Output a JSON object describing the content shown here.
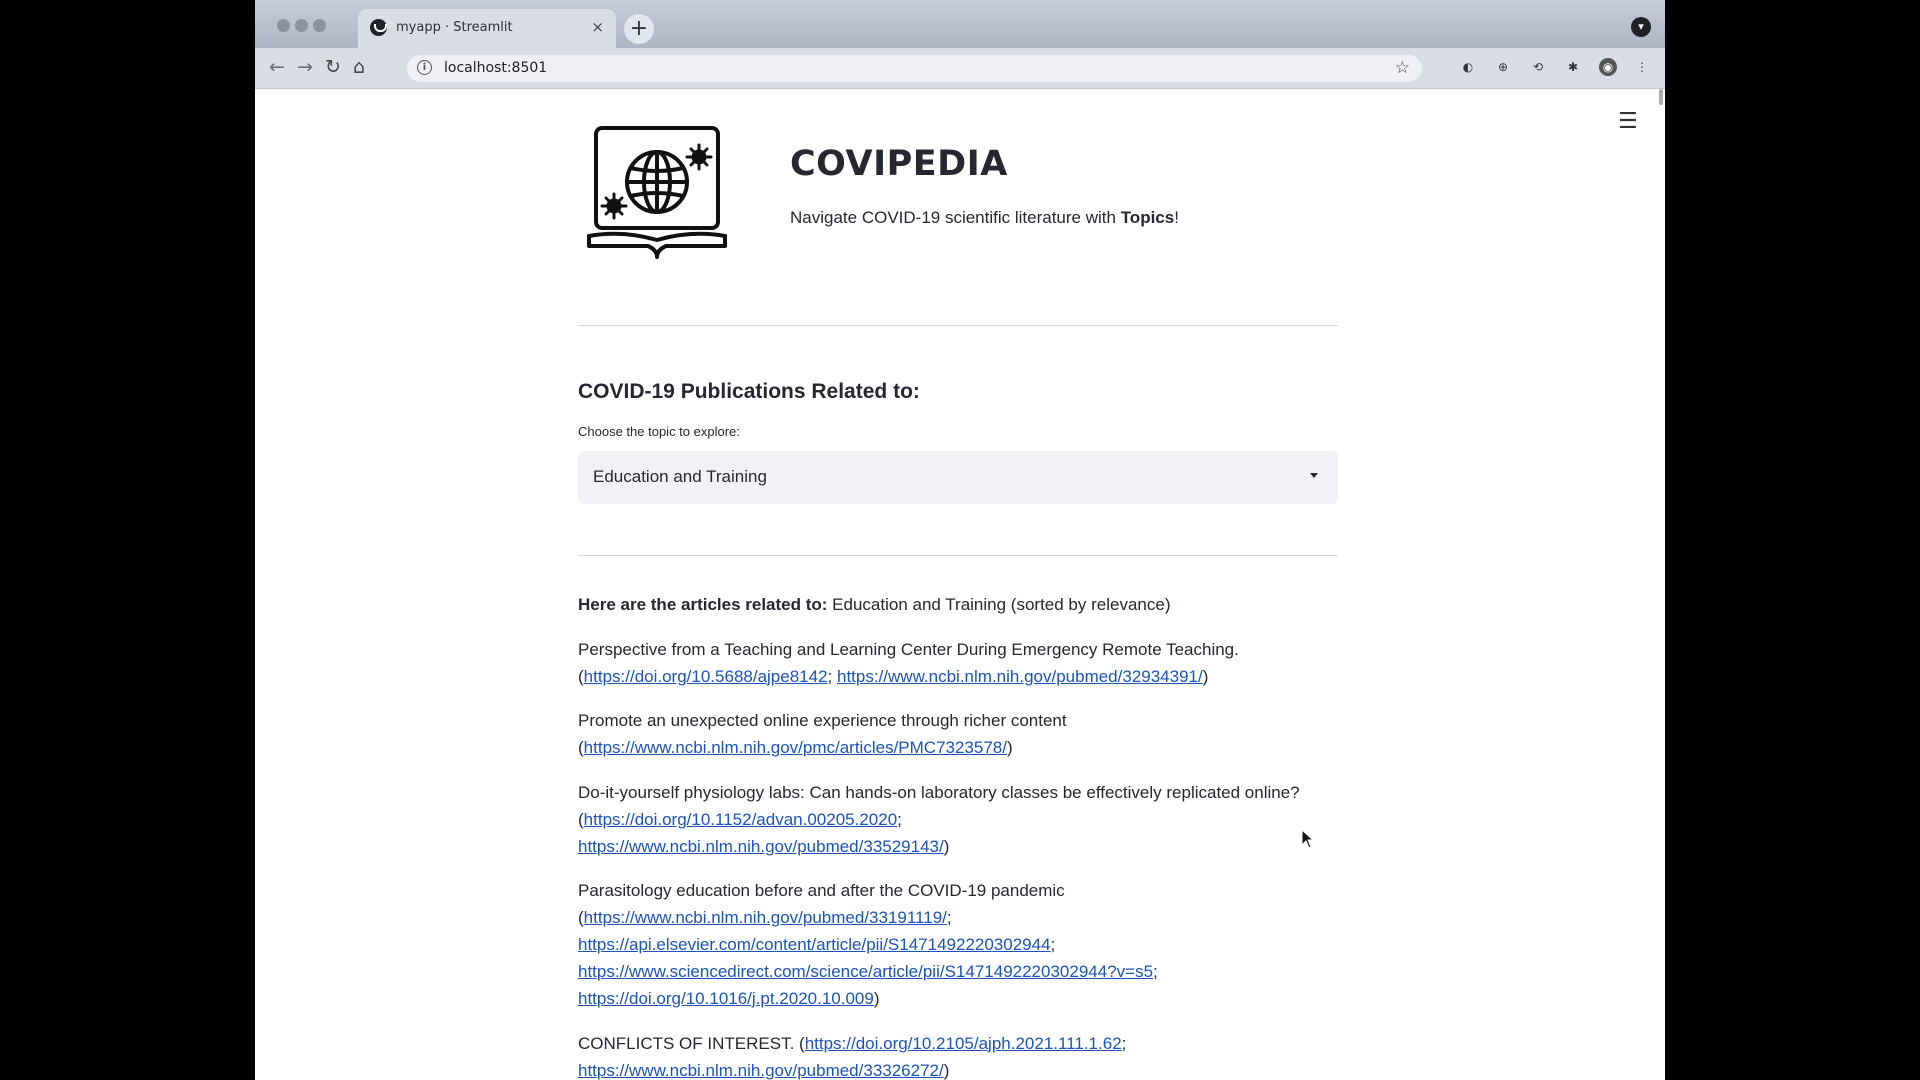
{
  "browser": {
    "tab_title": "myapp · Streamlit",
    "tab_close": "×",
    "new_tab": "+",
    "url": "localhost:8501",
    "info": "i",
    "star": "☆",
    "nav": {
      "back": "←",
      "forward": "→",
      "reload": "↻",
      "home": "⌂"
    },
    "extensions": [
      "◐",
      "⊕",
      "⟲",
      "✱",
      "◉"
    ],
    "menu": "⋮"
  },
  "app": {
    "menu_icon": "☰",
    "title": "COVIPEDIA",
    "tagline_prefix": "Navigate COVID-19 scientific literature with ",
    "tagline_bold": "Topics",
    "tagline_suffix": "!",
    "section_title": "COVID-19 Publications Related to:",
    "select_label": "Choose the topic to explore:",
    "selected_topic": "Education and Training",
    "results_heading_bold": "Here are the articles related to:",
    "results_heading_rest": " Education and Training (sorted by relevance)"
  },
  "articles": [
    {
      "title": "Perspective from a Teaching and Learning Center During Emergency Remote Teaching.",
      "links": [
        "https://doi.org/10.5688/ajpe8142",
        "https://www.ncbi.nlm.nih.gov/pubmed/32934391/"
      ]
    },
    {
      "title": "Promote an unexpected online experience through richer content",
      "links": [
        "https://www.ncbi.nlm.nih.gov/pmc/articles/PMC7323578/"
      ]
    },
    {
      "title": "Do-it-yourself physiology labs: Can hands-on laboratory classes be effectively replicated online?",
      "links": [
        "https://doi.org/10.1152/advan.00205.2020",
        "https://www.ncbi.nlm.nih.gov/pubmed/33529143/"
      ]
    },
    {
      "title": "Parasitology education before and after the COVID-19 pandemic",
      "links": [
        "https://www.ncbi.nlm.nih.gov/pubmed/33191119/",
        "https://api.elsevier.com/content/article/pii/S1471492220302944",
        "https://www.sciencedirect.com/science/article/pii/S1471492220302944?v=s5",
        "https://doi.org/10.1016/j.pt.2020.10.009"
      ]
    },
    {
      "title": "CONFLICTS OF INTEREST.",
      "links": [
        "https://doi.org/10.2105/ajph.2021.111.1.62",
        "https://www.ncbi.nlm.nih.gov/pubmed/33326272/"
      ]
    }
  ]
}
